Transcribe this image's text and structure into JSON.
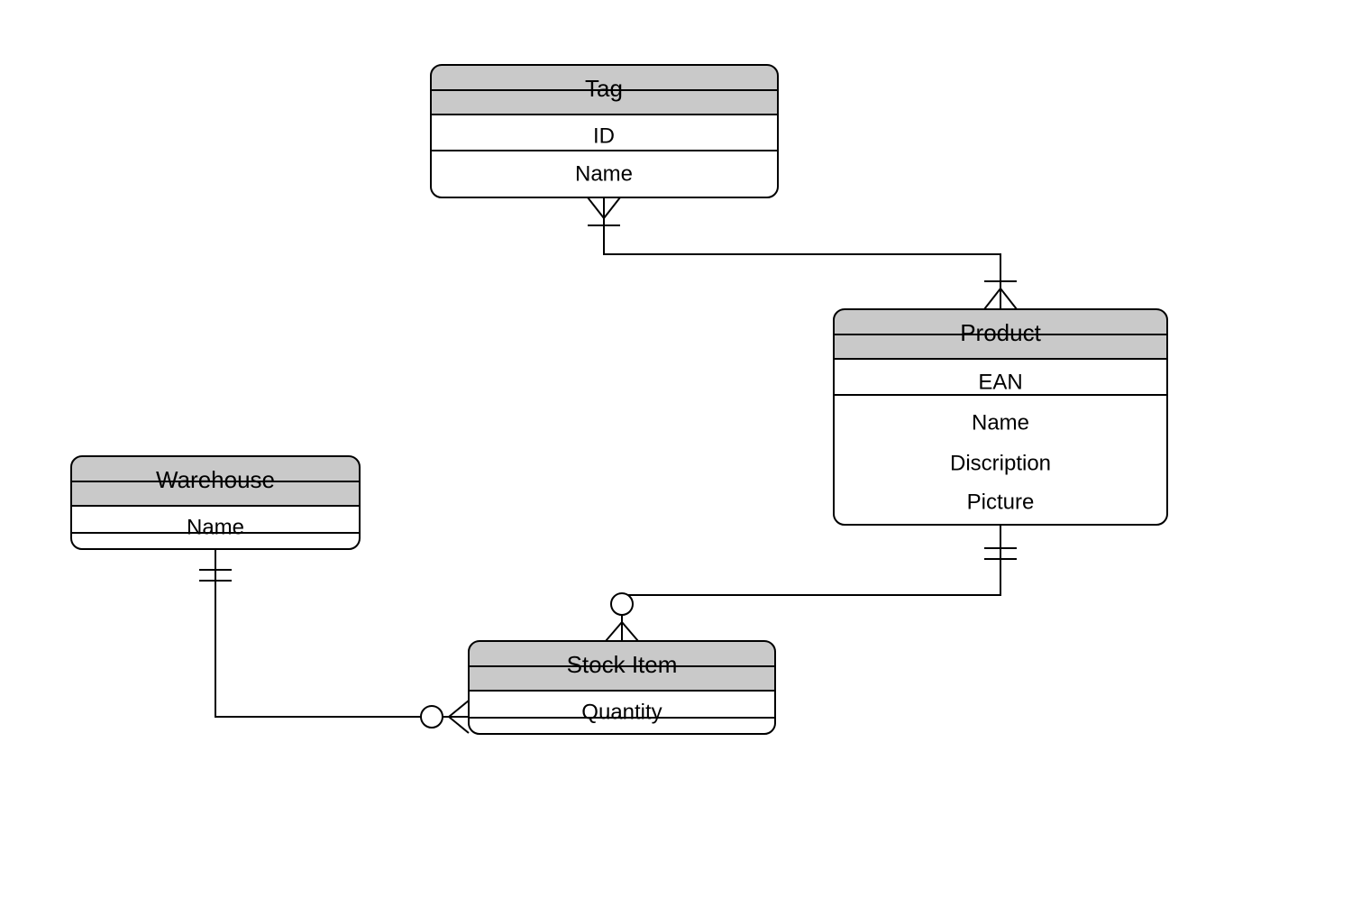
{
  "diagram": {
    "type": "ER diagram (crow's foot notation)",
    "entities": {
      "tag": {
        "title": "Tag",
        "attributes": [
          "ID",
          "Name"
        ]
      },
      "product": {
        "title": "Product",
        "attributes": [
          "EAN",
          "Name",
          "Discription",
          "Picture"
        ]
      },
      "warehouse": {
        "title": "Warehouse",
        "attributes": [
          "Name"
        ]
      },
      "stockitem": {
        "title": "Stock Item",
        "attributes": [
          "Quantity"
        ]
      }
    },
    "relationships": [
      {
        "from": "Tag",
        "from_card": "one-or-many",
        "to": "Product",
        "to_card": "one-or-many"
      },
      {
        "from": "Product",
        "from_card": "exactly-one",
        "to": "Stock Item",
        "to_card": "zero-or-many"
      },
      {
        "from": "Warehouse",
        "from_card": "exactly-one",
        "to": "Stock Item",
        "to_card": "zero-or-many"
      }
    ]
  }
}
